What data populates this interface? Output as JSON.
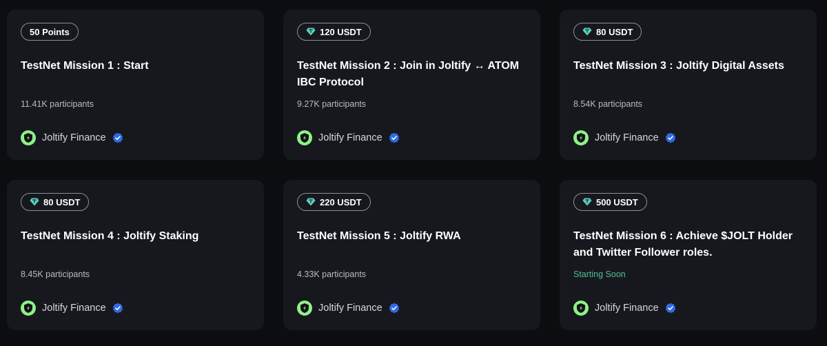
{
  "missions": [
    {
      "reward_label": "50 Points",
      "reward_icon": "",
      "title": "TestNet Mission 1 : Start",
      "participants": "11.41K participants",
      "org_name": "Joltify Finance",
      "org_logo": "joltify-logo-icon",
      "verified_icon": "verified-badge-icon"
    },
    {
      "reward_label": "120 USDT",
      "reward_icon": "usdt-diamond-icon",
      "title": "TestNet Mission 2 : Join in Joltify ↔ ATOM IBC Protocol",
      "participants": "9.27K participants",
      "org_name": "Joltify Finance",
      "org_logo": "joltify-logo-icon",
      "verified_icon": "verified-badge-icon"
    },
    {
      "reward_label": "80 USDT",
      "reward_icon": "usdt-diamond-icon",
      "title": "TestNet Mission 3 : Joltify Digital Assets",
      "participants": "8.54K participants",
      "org_name": "Joltify Finance",
      "org_logo": "joltify-logo-icon",
      "verified_icon": "verified-badge-icon"
    },
    {
      "reward_label": "80 USDT",
      "reward_icon": "usdt-diamond-icon",
      "title": "TestNet Mission 4 : Joltify Staking",
      "participants": "8.45K participants",
      "org_name": "Joltify Finance",
      "org_logo": "joltify-logo-icon",
      "verified_icon": "verified-badge-icon"
    },
    {
      "reward_label": "220 USDT",
      "reward_icon": "usdt-diamond-icon",
      "title": "TestNet Mission 5 : Joltify RWA",
      "participants": "4.33K participants",
      "org_name": "Joltify Finance",
      "org_logo": "joltify-logo-icon",
      "verified_icon": "verified-badge-icon"
    },
    {
      "reward_label": "500 USDT",
      "reward_icon": "usdt-diamond-icon",
      "title": "TestNet Mission 6 : Achieve $JOLT Holder and Twitter Follower roles.",
      "participants": "Starting Soon",
      "org_name": "Joltify Finance",
      "org_logo": "joltify-logo-icon",
      "verified_icon": "verified-badge-icon"
    }
  ],
  "colors": {
    "background": "#0c0d10",
    "card": "#17181d",
    "badge_border": "#8d8f96",
    "status_green": "#4fbf95",
    "verified_blue": "#2f6ae6",
    "logo_green": "#8ef08a",
    "gem_teal": "#5fd0c0"
  }
}
